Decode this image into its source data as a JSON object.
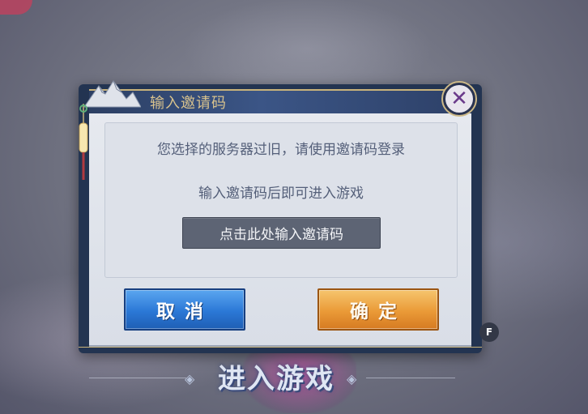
{
  "background": {
    "title": "进入游戏",
    "title_deco": "◈"
  },
  "dialog": {
    "title": "输入邀请码",
    "message_line1": "您选择的服务器过旧，请使用邀请码登录",
    "message_line2": "输入邀请码后即可进入游戏",
    "input_label": "点击此处输入邀请码",
    "cancel_label": "取消",
    "confirm_label": "确定",
    "close_icon": "close-icon"
  },
  "hotkey_badge": "F",
  "colors": {
    "cancel": "#2b78d6",
    "confirm": "#ea9a37",
    "title_gold": "#d8c28d",
    "frame": "#233451"
  }
}
